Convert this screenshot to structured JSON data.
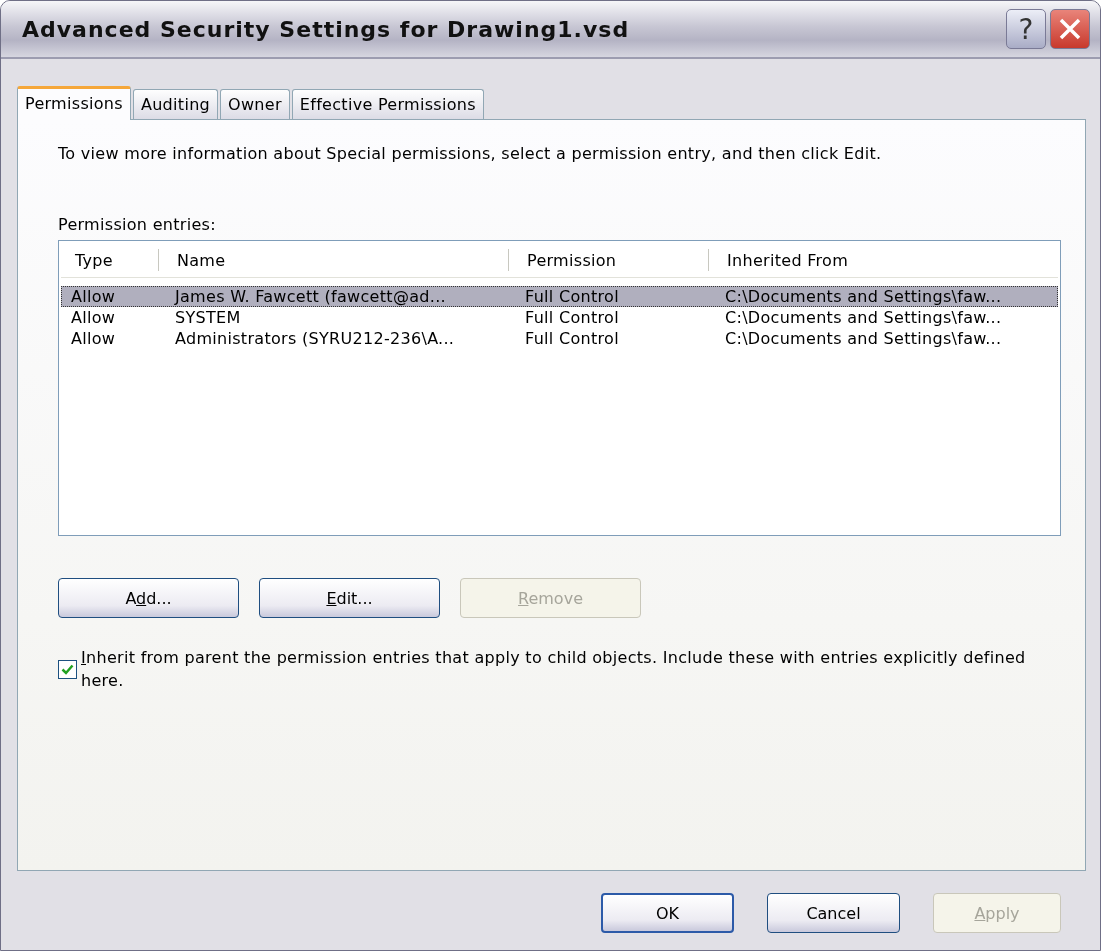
{
  "window": {
    "title": "Advanced Security Settings for Drawing1.vsd",
    "help": "?"
  },
  "tabs": [
    {
      "label": "Permissions",
      "selected": true
    },
    {
      "label": "Auditing",
      "selected": false
    },
    {
      "label": "Owner",
      "selected": false
    },
    {
      "label": "Effective Permissions",
      "selected": false
    }
  ],
  "description": "To view more information about Special permissions, select a permission entry, and then click Edit.",
  "list_label": "Permission entries:",
  "table": {
    "columns": [
      "Type",
      "Name",
      "Permission",
      "Inherited From"
    ],
    "rows": [
      {
        "cells": [
          "Allow",
          "James W. Fawcett (fawcett@ad...",
          "Full Control",
          "C:\\Documents and Settings\\faw..."
        ],
        "selected": true
      },
      {
        "cells": [
          "Allow",
          "SYSTEM",
          "Full Control",
          "C:\\Documents and Settings\\faw..."
        ],
        "selected": false
      },
      {
        "cells": [
          "Allow",
          "Administrators (SYRU212-236\\A...",
          "Full Control",
          "C:\\Documents and Settings\\faw..."
        ],
        "selected": false
      }
    ]
  },
  "entry_buttons": [
    {
      "label_parts": [
        {
          "text": "A",
          "underlined": false
        },
        {
          "text": "d",
          "underlined": true
        },
        {
          "text": "d...",
          "underlined": false
        }
      ],
      "disabled": false
    },
    {
      "label_parts": [
        {
          "text": "E",
          "underlined": true
        },
        {
          "text": "dit...",
          "underlined": false
        }
      ],
      "disabled": false
    },
    {
      "label_parts": [
        {
          "text": "R",
          "underlined": true
        },
        {
          "text": "emove",
          "underlined": false
        }
      ],
      "disabled": true
    }
  ],
  "inherit": {
    "label_parts": [
      {
        "text": "I",
        "underlined": true
      },
      {
        "text": "nherit from parent the permission entries that apply to child objects. Include these with entries explicitly defined here.",
        "underlined": false
      }
    ],
    "checked": true
  },
  "dialog_buttons": [
    {
      "label_parts": [
        {
          "text": "OK",
          "underlined": false
        }
      ],
      "default": true,
      "disabled": false
    },
    {
      "label_parts": [
        {
          "text": "Cancel",
          "underlined": false
        }
      ],
      "default": false,
      "disabled": false
    },
    {
      "label_parts": [
        {
          "text": "A",
          "underlined": true
        },
        {
          "text": "pply",
          "underlined": false
        }
      ],
      "default": false,
      "disabled": true
    }
  ]
}
